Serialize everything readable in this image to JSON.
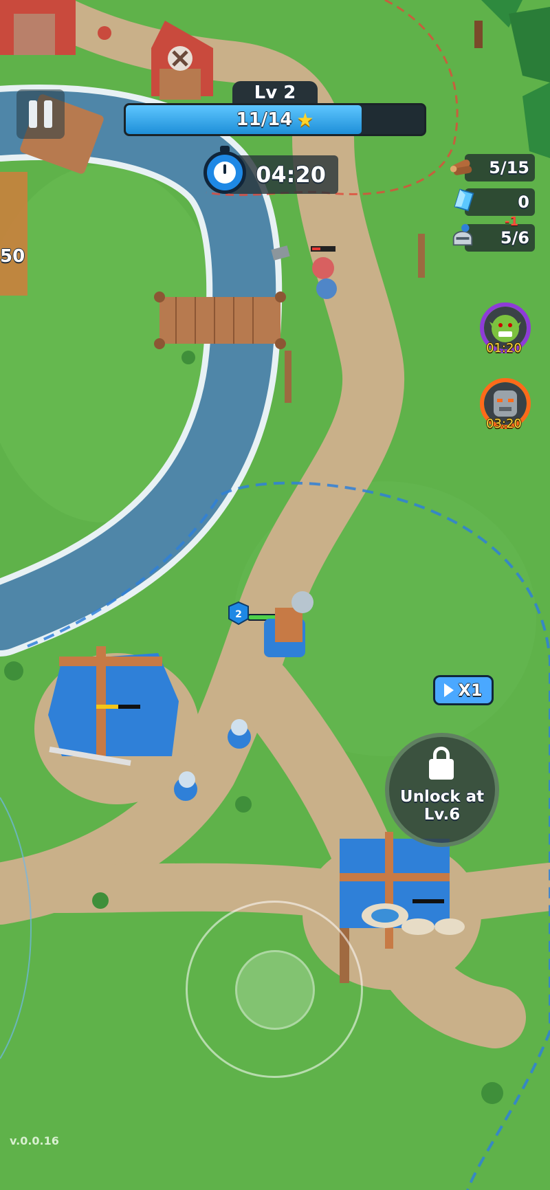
{
  "hud": {
    "level_label": "Lv 2",
    "xp_text": "11/14",
    "xp_progress": 0.79,
    "timer": "04:20",
    "pause_icon": "pause-icon",
    "star_icon": "star-icon"
  },
  "resources": [
    {
      "name": "wood",
      "icon": "wood-log-icon",
      "value": "5/15"
    },
    {
      "name": "crystal",
      "icon": "blue-crystal-icon",
      "value": "0"
    },
    {
      "name": "soldiers",
      "icon": "knight-helmet-icon",
      "value": "5/6"
    }
  ],
  "soldier_delta": "-1",
  "waves": [
    {
      "enemy": "goblin",
      "icon": "goblin-face-icon",
      "time": "01:20",
      "ring_color": "#8e3bd8",
      "progress": 0.6
    },
    {
      "enemy": "golem",
      "icon": "stone-golem-face-icon",
      "time": "03:20",
      "ring_color": "#ff6a1a",
      "progress": 0.45
    }
  ],
  "speed_button": {
    "label": "X1",
    "icon": "play-icon"
  },
  "locked_area": {
    "label": "Unlock at Lv.6",
    "icon": "lock-icon"
  },
  "player": {
    "level": "2",
    "health": 1.0
  },
  "side_value": "50",
  "version": "v.0.0.16",
  "colors": {
    "grass": "#5fb24a",
    "path": "#c9b089",
    "river": "#4f86a8",
    "blue_team": "#2f80d8",
    "red_team": "#d33a2f"
  }
}
